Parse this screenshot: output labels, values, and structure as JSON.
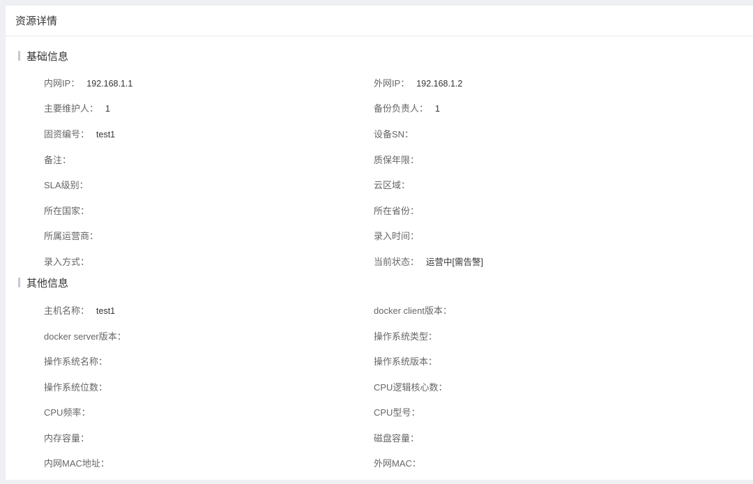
{
  "header": {
    "title": "资源详情"
  },
  "sections": [
    {
      "title": "基础信息",
      "rows": [
        [
          {
            "label": "内网IP：",
            "value": "192.168.1.1"
          },
          {
            "label": "外网IP：",
            "value": "192.168.1.2"
          }
        ],
        [
          {
            "label": "主要维护人：",
            "value": "1"
          },
          {
            "label": "备份负责人：",
            "value": "1"
          }
        ],
        [
          {
            "label": "固资编号：",
            "value": "test1"
          },
          {
            "label": "设备SN：",
            "value": ""
          }
        ],
        [
          {
            "label": "备注：",
            "value": ""
          },
          {
            "label": "质保年限：",
            "value": ""
          }
        ],
        [
          {
            "label": "SLA级别：",
            "value": ""
          },
          {
            "label": "云区域：",
            "value": ""
          }
        ],
        [
          {
            "label": "所在国家：",
            "value": ""
          },
          {
            "label": "所在省份：",
            "value": ""
          }
        ],
        [
          {
            "label": "所属运营商：",
            "value": ""
          },
          {
            "label": "录入时间：",
            "value": ""
          }
        ],
        [
          {
            "label": "录入方式：",
            "value": ""
          },
          {
            "label": "当前状态：",
            "value": "运营中[需告警]"
          }
        ]
      ]
    },
    {
      "title": "其他信息",
      "rows": [
        [
          {
            "label": "主机名称：",
            "value": "test1"
          },
          {
            "label": "docker client版本：",
            "value": ""
          }
        ],
        [
          {
            "label": "docker server版本：",
            "value": ""
          },
          {
            "label": "操作系统类型：",
            "value": ""
          }
        ],
        [
          {
            "label": "操作系统名称：",
            "value": ""
          },
          {
            "label": "操作系统版本：",
            "value": ""
          }
        ],
        [
          {
            "label": "操作系统位数：",
            "value": ""
          },
          {
            "label": "CPU逻辑核心数：",
            "value": ""
          }
        ],
        [
          {
            "label": "CPU频率：",
            "value": ""
          },
          {
            "label": "CPU型号：",
            "value": ""
          }
        ],
        [
          {
            "label": "内存容量：",
            "value": ""
          },
          {
            "label": "磁盘容量：",
            "value": ""
          }
        ],
        [
          {
            "label": "内网MAC地址：",
            "value": ""
          },
          {
            "label": "外网MAC：",
            "value": ""
          }
        ]
      ]
    }
  ]
}
